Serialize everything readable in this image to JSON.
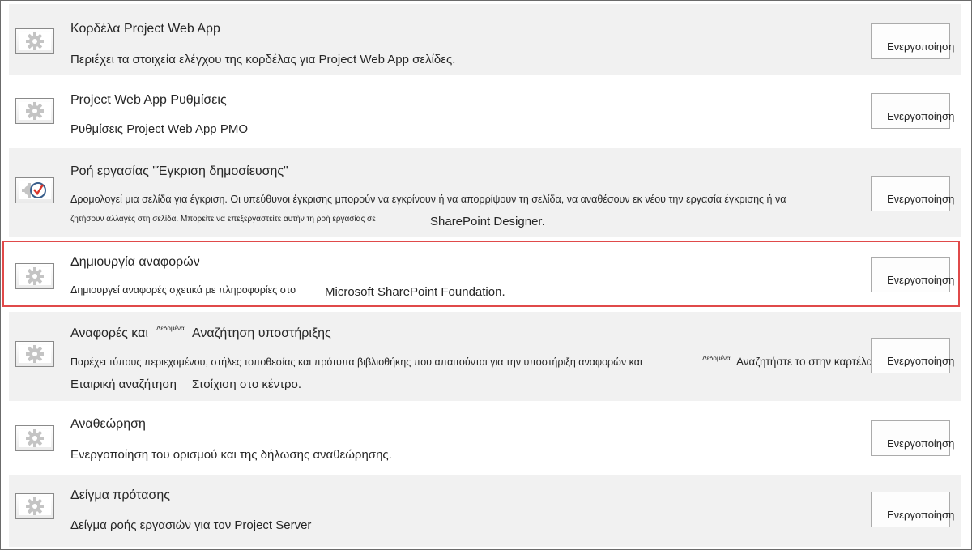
{
  "features": [
    {
      "title": "Κορδέλα Project Web App",
      "description": "Περιέχει τα στοιχεία ελέγχου της κορδέλας για Project Web App σελίδες.",
      "button_label": "Ενεργοποίηση",
      "icon": "gear-icon"
    },
    {
      "title": "Project Web App Ρυθμίσεις",
      "description": "Ρυθμίσεις Project Web App PMO",
      "button_label": "Ενεργοποίηση",
      "icon": "gear-icon"
    },
    {
      "title": "Ροή εργασίας \"Έγκριση δημοσίευσης\"",
      "description_line1": "Δρομολογεί μια σελίδα για έγκριση. Οι υπεύθυνοι έγκρισης μπορούν να εγκρίνουν ή να απορρίψουν τη σελίδα, να αναθέσουν εκ νέου την εργασία έγκρισης ή να",
      "description_line2": "ζητήσουν αλλαγές στη σελίδα. Μπορείτε να επεξεργαστείτε αυτήν τη ροή εργασίας σε",
      "description_line2_suffix": "SharePoint Designer.",
      "button_label": "Ενεργοποίηση",
      "icon": "workflow-approval-icon"
    },
    {
      "title": "Δημιουργία αναφορών",
      "description": "Δημιουργεί αναφορές σχετικά με πληροφορίες στο",
      "description_suffix": "Microsoft SharePoint Foundation.",
      "button_label": "Ενεργοποίηση",
      "icon": "gear-icon",
      "highlighted": true
    },
    {
      "title_prefix": "Αναφορές και",
      "title_tiny": "Δεδομένα",
      "title_suffix": "Αναζήτηση υποστήριξης",
      "description_line1": "Παρέχει τύπους περιεχομένου, στήλες τοποθεσίας και πρότυπα βιβλιοθήκης που απαιτούνται για την υποστήριξη αναφορών και",
      "description_line1_tiny": "Δεδομένα",
      "description_line1_suffix": "Αναζητήστε το στην καρτέλα",
      "description_line2": "Εταιρική αναζήτηση",
      "description_line2_suffix": "Στοίχιση στο κέντρο.",
      "button_label": "Ενεργοποίηση",
      "icon": "gear-icon"
    },
    {
      "title": "Αναθεώρηση",
      "description": "Ενεργοποίηση του ορισμού και της δήλωσης αναθεώρησης.",
      "button_label": "Ενεργοποίηση",
      "icon": "gear-icon"
    },
    {
      "title": "Δείγμα πρότασης",
      "description": "Δείγμα ροής εργασιών για τον Project Server",
      "button_label": "Ενεργοποίηση",
      "icon": "gear-icon"
    }
  ]
}
